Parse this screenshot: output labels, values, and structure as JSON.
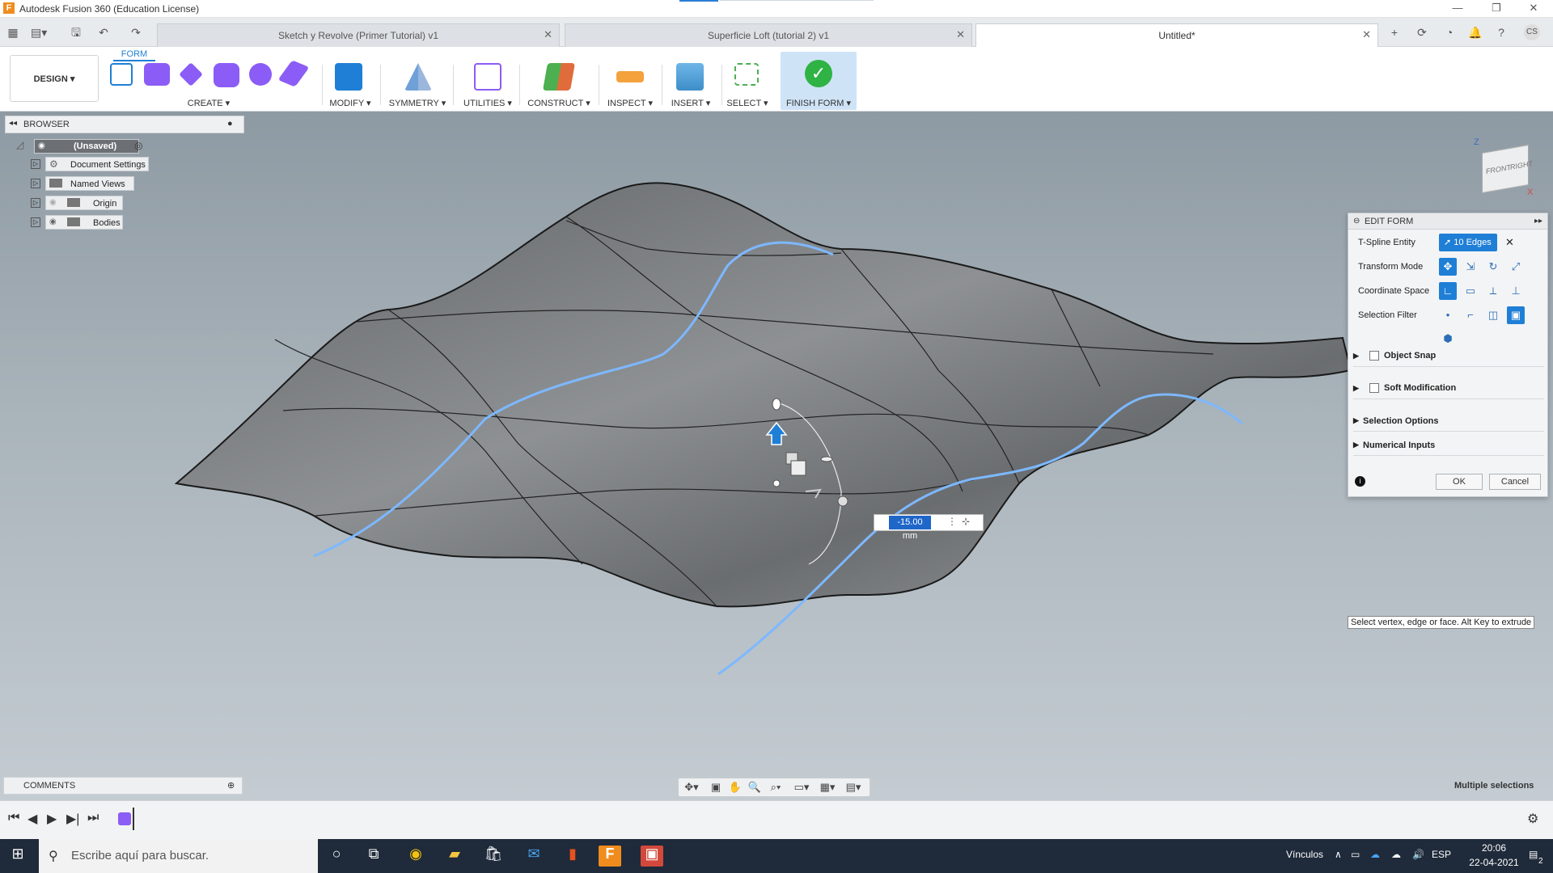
{
  "window": {
    "title": "Autodesk Fusion 360 (Education License)"
  },
  "tabs": [
    {
      "label": "Sketch y Revolve (Primer Tutorial) v1",
      "active": false
    },
    {
      "label": "Superficie Loft (tutorial 2) v1",
      "active": false
    },
    {
      "label": "Untitled*",
      "active": true
    }
  ],
  "ribbon": {
    "active_tab": "FORM",
    "workspace": "DESIGN ▾",
    "groups": [
      "CREATE ▾",
      "MODIFY ▾",
      "SYMMETRY ▾",
      "UTILITIES ▾",
      "CONSTRUCT ▾",
      "INSPECT ▾",
      "INSERT ▾",
      "SELECT ▾",
      "FINISH FORM ▾"
    ]
  },
  "browser": {
    "title": "BROWSER",
    "root": "(Unsaved)",
    "items": [
      "Document Settings",
      "Named Views",
      "Origin",
      "Bodies"
    ]
  },
  "edit_form": {
    "title": "EDIT FORM",
    "tspline_label": "T-Spline Entity",
    "tspline_value": "10 Edges",
    "transform_label": "Transform Mode",
    "coordinate_label": "Coordinate Space",
    "filter_label": "Selection Filter",
    "object_snap": "Object Snap",
    "soft_mod": "Soft Modification",
    "selection_options": "Selection Options",
    "numerical_inputs": "Numerical Inputs",
    "ok": "OK",
    "cancel": "Cancel"
  },
  "dimension_value": "-15.00 mm",
  "hint": "Select vertex, edge or face. Alt Key to extrude",
  "status": "Multiple selections",
  "comments": {
    "title": "COMMENTS"
  },
  "viewcube": {
    "front": "FRONT",
    "right": "RIGHT",
    "axis_z": "Z",
    "axis_x": "X"
  },
  "taskbar": {
    "search_placeholder": "Escribe aquí para buscar.",
    "vinculos": "Vínculos",
    "lang": "ESP",
    "time": "20:06",
    "date": "22-04-2021",
    "notifications": "2"
  },
  "colors": {
    "accent": "#1f7fd6",
    "surface": "#7b7e80",
    "selection": "#6fb0ff"
  }
}
